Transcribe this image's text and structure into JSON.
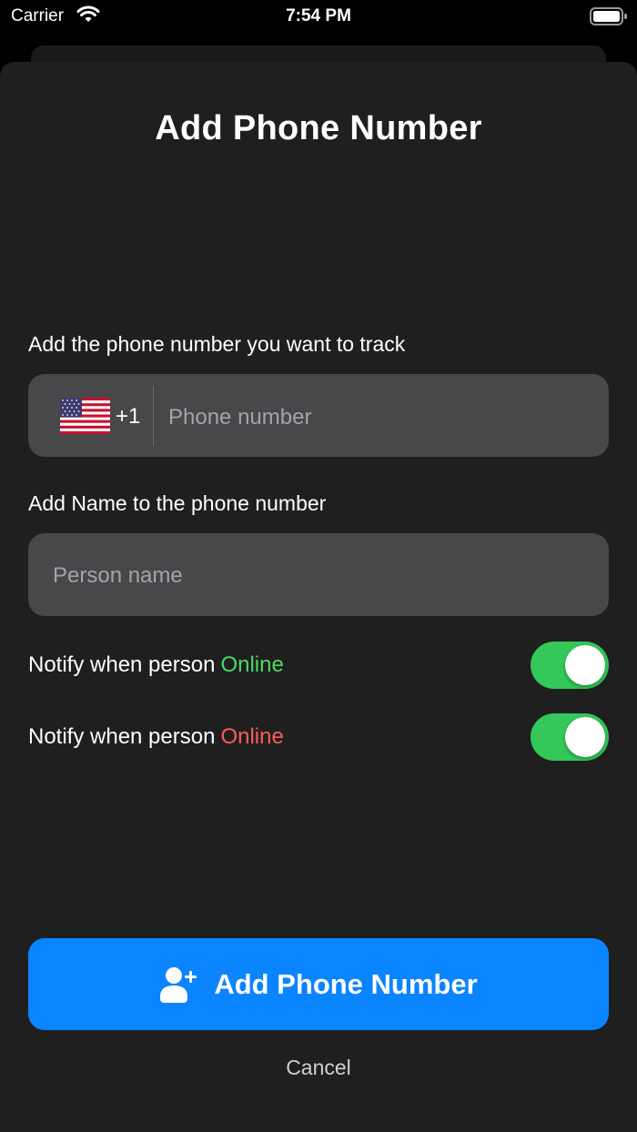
{
  "status_bar": {
    "carrier": "Carrier",
    "time": "7:54 PM",
    "icons": [
      "wifi-icon",
      "battery-icon"
    ]
  },
  "sheet": {
    "title": "Add Phone Number"
  },
  "phone_section": {
    "label": "Add the phone number you want to track",
    "country_flag": "us-flag-icon",
    "dial_code": "+1",
    "phone_placeholder": "Phone number",
    "phone_value": ""
  },
  "name_section": {
    "label": "Add Name to the phone number",
    "name_placeholder": "Person name",
    "name_value": ""
  },
  "notifications": [
    {
      "text": "Notify when person",
      "status": "Online",
      "status_color": "#4cd964",
      "enabled": true
    },
    {
      "text": "Notify when person",
      "status": "Online",
      "status_color": "#ff5a5f",
      "enabled": true
    }
  ],
  "actions": {
    "primary_label": "Add Phone Number",
    "primary_icon": "add-person-icon",
    "cancel_label": "Cancel"
  },
  "colors": {
    "accent": "#0a84ff",
    "toggle_on": "#34c759",
    "sheet_bg": "#1f1f1f",
    "field_bg": "#48484a"
  }
}
